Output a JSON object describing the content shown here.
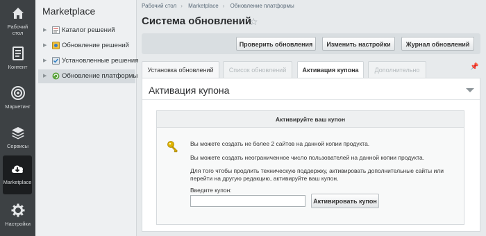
{
  "rail": [
    {
      "icon": "home-icon",
      "label_lines": [
        "Рабочий",
        "стол"
      ]
    },
    {
      "icon": "content-icon",
      "label_lines": [
        "Контент"
      ]
    },
    {
      "icon": "target-icon",
      "label_lines": [
        "Маркетинг"
      ]
    },
    {
      "icon": "layers-icon",
      "label_lines": [
        "Сервисы"
      ]
    },
    {
      "icon": "cloud-download-icon",
      "label_lines": [
        "Marketplace"
      ],
      "active": true
    },
    {
      "icon": "gear-icon",
      "label_lines": [
        "Настройки"
      ]
    }
  ],
  "sidebar": {
    "title": "Marketplace",
    "items": [
      {
        "label": "Каталог решений",
        "icon": "catalog-icon"
      },
      {
        "label": "Обновление решений",
        "icon": "solutions-update-icon"
      },
      {
        "label": "Установленные решения",
        "icon": "installed-icon"
      },
      {
        "label": "Обновление платформы",
        "icon": "platform-update-icon",
        "active": true
      }
    ]
  },
  "breadcrumbs": [
    "Рабочий стол",
    "Marketplace",
    "Обновление платформы"
  ],
  "page": {
    "title": "Система обновлений"
  },
  "toolbar": {
    "check": "Проверить обновления",
    "settings": "Изменить настройки",
    "log": "Журнал обновлений"
  },
  "tabs": [
    {
      "label": "Установка обновлений",
      "state": "normal"
    },
    {
      "label": "Список обновлений",
      "state": "disabled"
    },
    {
      "label": "Активация купона",
      "state": "active"
    },
    {
      "label": "Дополнительно",
      "state": "disabled"
    }
  ],
  "panel": {
    "title": "Активация купона"
  },
  "coupon": {
    "header": "Активируйте ваш купон",
    "line1": "Вы можете создать не более 2 сайтов на данной копии продукта.",
    "line2": "Вы можете создать неограниченное число пользователей на данной копии продукта.",
    "line3a": "Для того чтобы продлить техническую поддержку, активировать дополнительные сайты или",
    "line3b": "перейти на другую редакцию, активируйте ваш купон.",
    "input_label": "Введите купон:",
    "input_value": "",
    "button": "Активировать купон"
  },
  "colors": {
    "rail": "#3d4144",
    "rail_active": "#1b1d1f",
    "accent_key": "#e0b400"
  }
}
